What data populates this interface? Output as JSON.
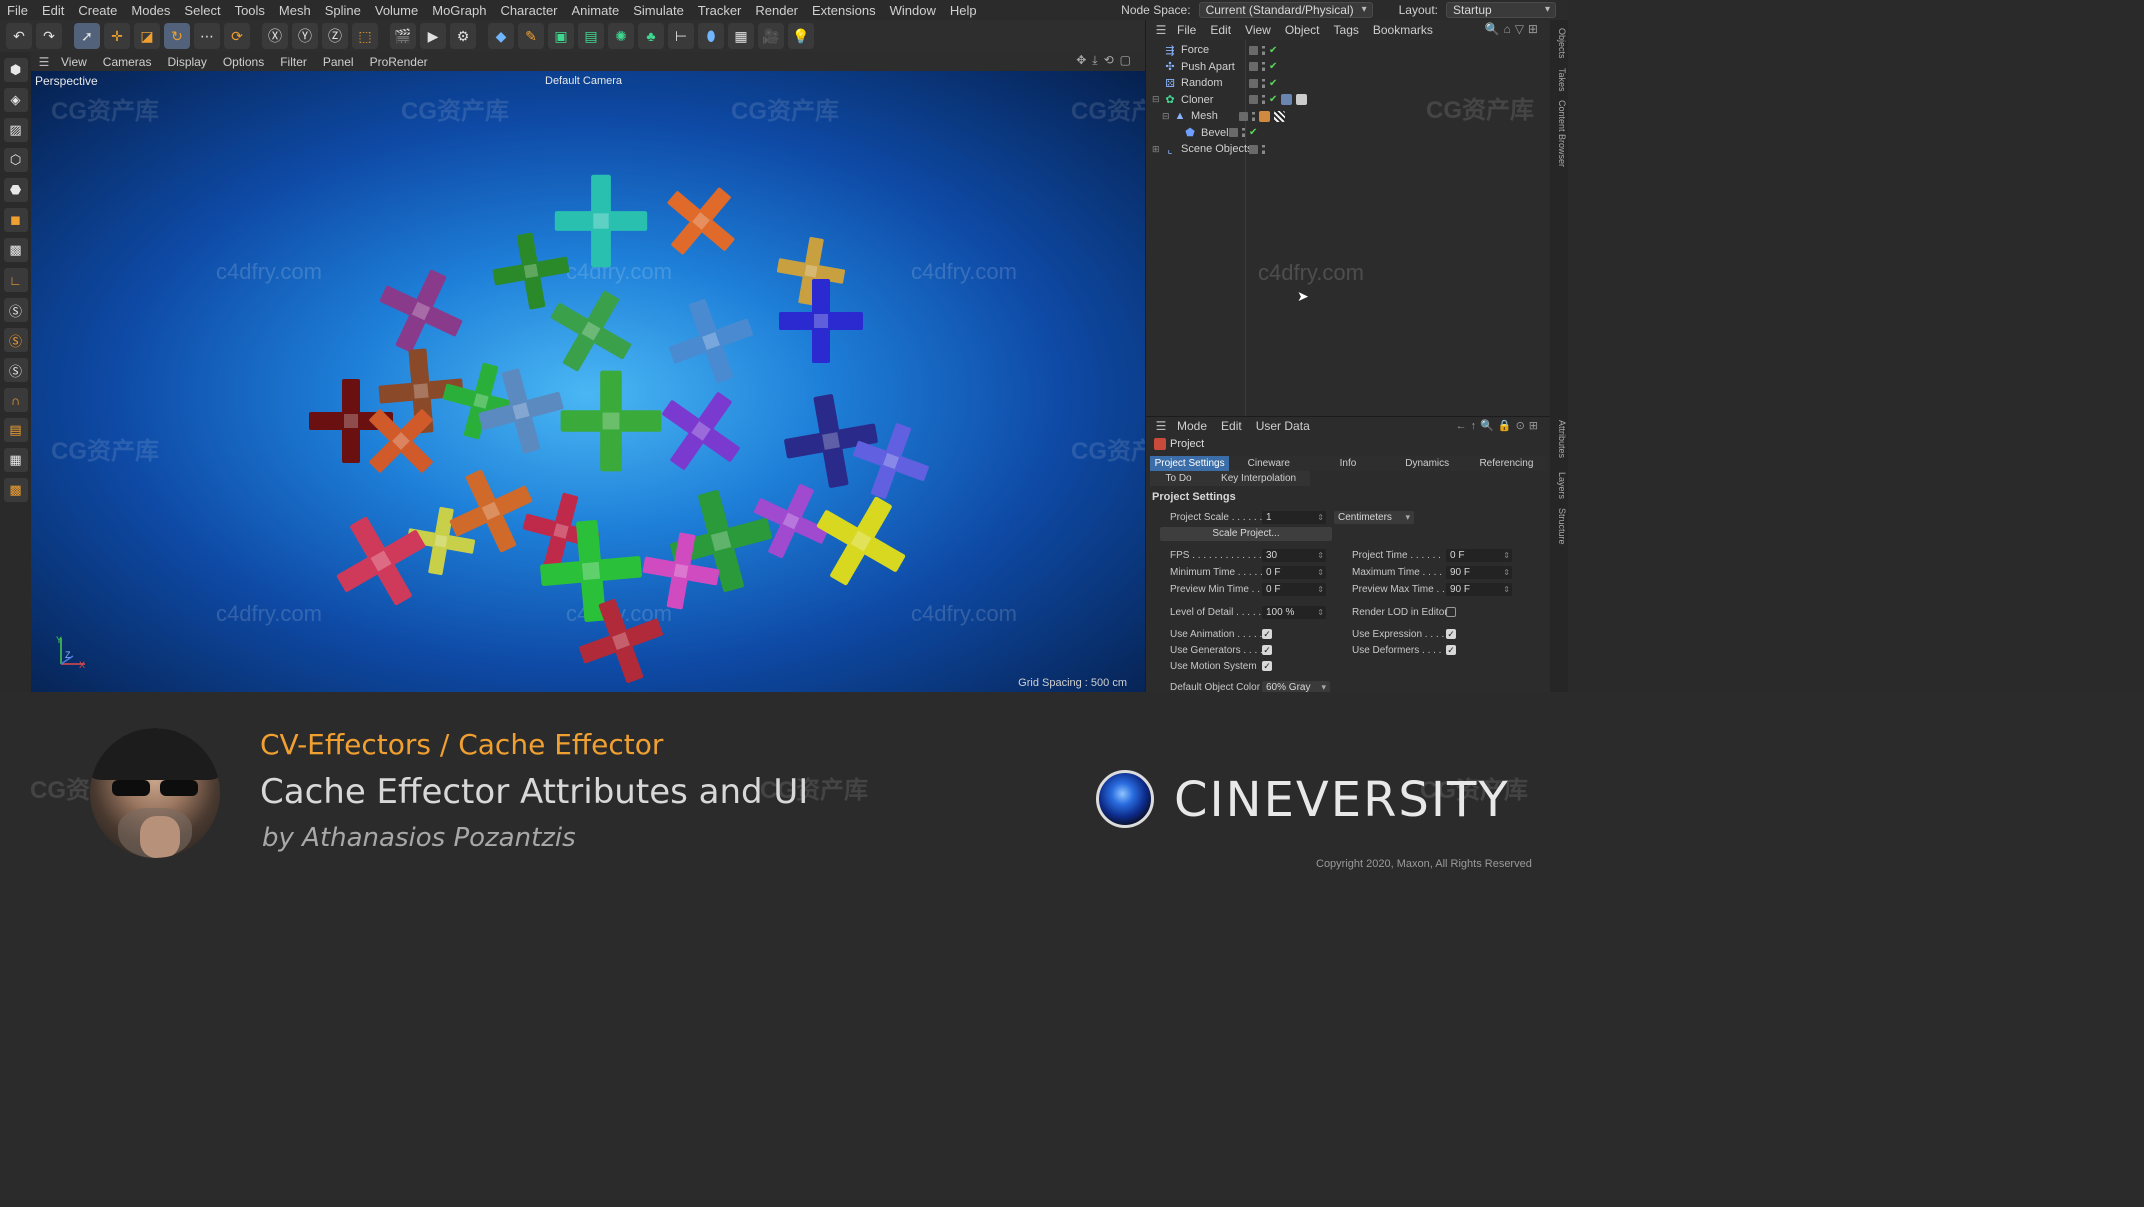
{
  "menubar": {
    "items": [
      "File",
      "Edit",
      "Create",
      "Modes",
      "Select",
      "Tools",
      "Mesh",
      "Spline",
      "Volume",
      "MoGraph",
      "Character",
      "Animate",
      "Simulate",
      "Tracker",
      "Render",
      "Extensions",
      "Window",
      "Help"
    ],
    "node_space_label": "Node Space:",
    "node_space_value": "Current (Standard/Physical)",
    "layout_label": "Layout:",
    "layout_value": "Startup"
  },
  "viewport": {
    "menu": [
      "View",
      "Cameras",
      "Display",
      "Options",
      "Filter",
      "Panel",
      "ProRender"
    ],
    "label": "Perspective",
    "camera": "Default Camera",
    "grid_spacing": "Grid Spacing : 500 cm",
    "axis_y": "Y",
    "axis_x": "X",
    "axis_z": "Z",
    "watermark_cn": "CG资产库",
    "watermark_en": "c4dfry.com"
  },
  "object_manager": {
    "menu": [
      "File",
      "Edit",
      "View",
      "Object",
      "Tags",
      "Bookmarks"
    ],
    "objects": [
      {
        "name": "Force",
        "icon_color": "#8ab4ff"
      },
      {
        "name": "Push Apart",
        "icon_color": "#8ab4ff"
      },
      {
        "name": "Random",
        "icon_color": "#8ab4ff"
      },
      {
        "name": "Cloner",
        "icon_color": "#40d890"
      },
      {
        "name": "Mesh",
        "icon_color": "#8ab4ff"
      },
      {
        "name": "Bevel",
        "icon_color": "#6fa0ff"
      },
      {
        "name": "Scene Objects",
        "icon_color": "#8ab4ff"
      }
    ]
  },
  "side_tabs": [
    "Objects",
    "Takes",
    "Content Browser",
    "Attributes",
    "Layers",
    "Structure"
  ],
  "attributes": {
    "menu": [
      "Mode",
      "Edit",
      "User Data"
    ],
    "object": "Project",
    "tabs": [
      "Project Settings",
      "Cineware",
      "Info",
      "Dynamics",
      "Referencing"
    ],
    "tabs2": [
      "To Do",
      "Key Interpolation"
    ],
    "section": "Project Settings",
    "project_scale_label": "Project Scale . . . . . .",
    "project_scale_value": "1",
    "project_scale_unit": "Centimeters",
    "scale_button": "Scale Project...",
    "fps_label": "FPS . . . . . . . . . . . . . . .",
    "fps_value": "30",
    "project_time_label": "Project Time . . . . . .",
    "project_time_value": "0 F",
    "min_time_label": "Minimum Time . . . . .",
    "min_time_value": "0 F",
    "max_time_label": "Maximum Time . . . .",
    "max_time_value": "90 F",
    "prev_min_label": "Preview Min Time . .",
    "prev_min_value": "0 F",
    "prev_max_label": "Preview Max Time . .",
    "prev_max_value": "90 F",
    "lod_label": "Level of Detail . . . . .",
    "lod_value": "100 %",
    "render_lod_label": "Render LOD in Editor",
    "use_anim_label": "Use Animation . . . . .",
    "use_expr_label": "Use Expression . . . .",
    "use_gen_label": "Use Generators . . . .",
    "use_def_label": "Use Deformers . . . .",
    "use_motion_label": "Use Motion System",
    "default_color_label": "Default Object Color",
    "default_color_value": "60% Gray"
  },
  "lower_third": {
    "title": "CV-Effectors / Cache Effector",
    "subtitle": "Cache Effector Attributes and UI",
    "author": "by Athanasios Pozantzis",
    "brand": "CINEVERSITY",
    "copyright": "Copyright 2020, Maxon, All Rights Reserved"
  },
  "colors": {
    "accent_orange": "#f0a030",
    "tab_active": "#3b6ea8",
    "viewport_center": "#4ab7f4",
    "viewport_edge": "#06204d"
  }
}
